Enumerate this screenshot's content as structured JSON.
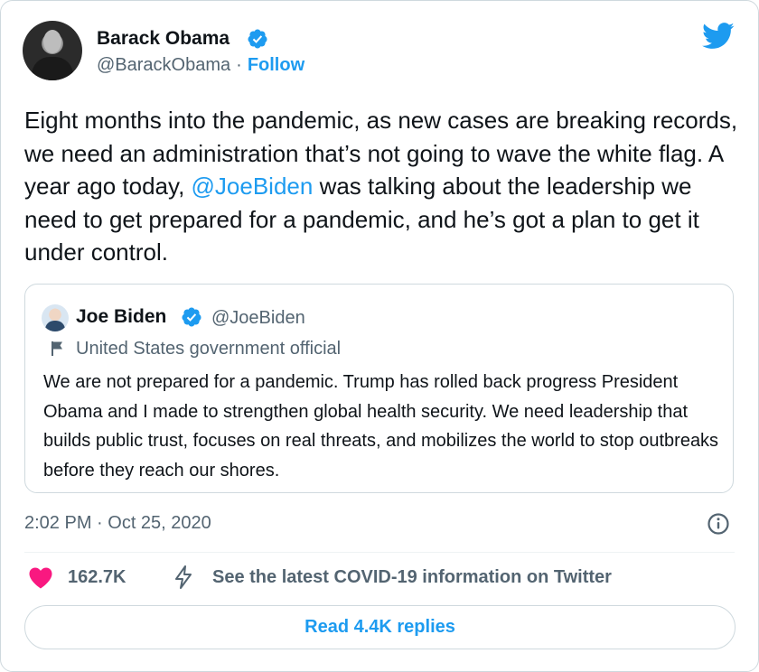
{
  "author": {
    "name": "Barack Obama",
    "handle": "@BarackObama",
    "separator": "·",
    "follow_label": "Follow"
  },
  "tweet": {
    "text_part1": "Eight months into the pandemic, as new cases are breaking records, we need an administration that’s not going to wave the white flag. A year ago today, ",
    "mention": "@JoeBiden",
    "text_part2": " was talking about the leadership we need to get prepared for a pandemic, and he’s got a plan to get it under control."
  },
  "quoted_tweet": {
    "name": "Joe Biden",
    "handle": "@JoeBiden",
    "label": "United States government official",
    "text": "We are not prepared for a pandemic. Trump has rolled back progress President Obama and I made to strengthen global health security. We need leadership that builds public trust, focuses on real threats, and mobilizes the world to stop outbreaks before they reach our shores."
  },
  "timestamp": "2:02 PM · Oct 25, 2020",
  "actions": {
    "like_count": "162.7K",
    "covid_info": "See the latest COVID-19 information on Twitter",
    "replies_label": "Read 4.4K replies"
  },
  "colors": {
    "accent": "#1d9bf0",
    "heart": "#f91880",
    "secondary_text": "#536471",
    "border": "#cfd9de"
  },
  "icons": [
    "verified-badge-icon",
    "twitter-bird-icon",
    "flag-icon",
    "info-icon",
    "heart-icon",
    "lightning-bolt-icon"
  ]
}
